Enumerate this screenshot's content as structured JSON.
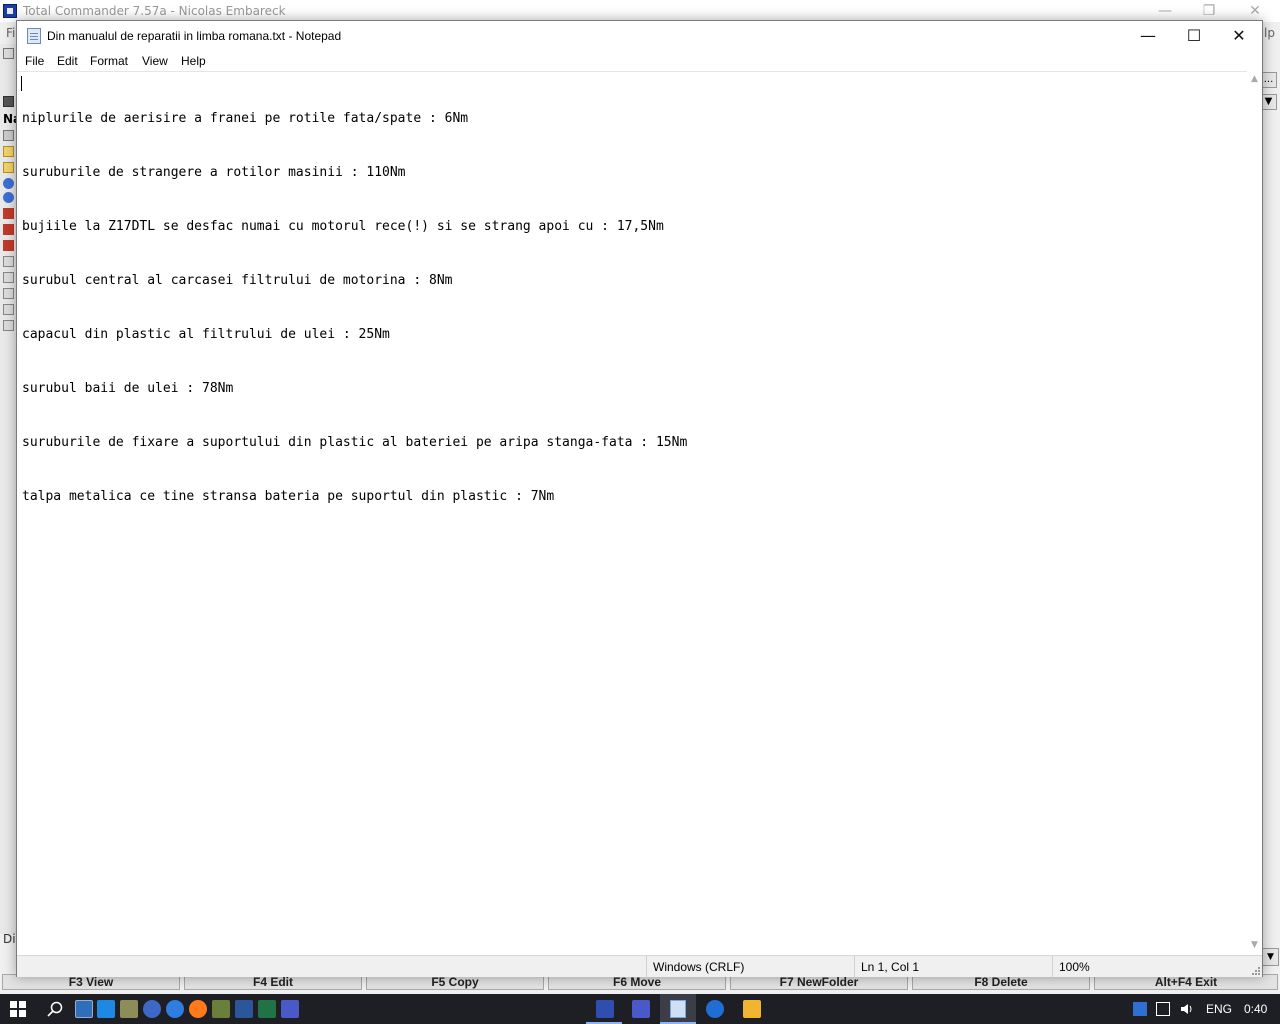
{
  "background_app": {
    "title": "Total Commander 7.57a - Nicolas Embareck",
    "menu_fragment": "Fi",
    "help_fragment": "lp",
    "left_fragment": "Na",
    "status_fragment": "Di",
    "fkeys": [
      "F3 View",
      "F4 Edit",
      "F5 Copy",
      "F6 Move",
      "F7 NewFolder",
      "F8 Delete",
      "Alt+F4 Exit"
    ],
    "dropdown_button": "...",
    "window_controls": {
      "minimize": "—",
      "restore": "❐",
      "close": "✕"
    }
  },
  "notepad": {
    "title": "Din manualul de reparatii in limba romana.txt - Notepad",
    "window_controls": {
      "minimize": "—",
      "maximize": "☐",
      "close": "✕"
    },
    "menu": [
      "File",
      "Edit",
      "Format",
      "View",
      "Help"
    ],
    "lines": [
      "niplurile de aerisire a franei pe rotile fata/spate : 6Nm",
      "suruburile de strangere a rotilor masinii : 110Nm",
      "bujiile la Z17DTL se desfac numai cu motorul rece(!) si se strang apoi cu : 17,5Nm",
      "surubul central al carcasei filtrului de motorina : 8Nm",
      "capacul din plastic al filtrului de ulei : 25Nm",
      "surubul baii de ulei : 78Nm",
      "suruburile de fixare a suportului din plastic al bateriei pe aripa stanga-fata : 15Nm",
      "talpa metalica ce tine stransa bateria pe suportul din plastic : 7Nm"
    ],
    "status": {
      "line_ending": "Windows (CRLF)",
      "position": "Ln 1, Col 1",
      "zoom": "100%"
    }
  },
  "taskbar": {
    "language": "ENG",
    "time": "0:40"
  }
}
